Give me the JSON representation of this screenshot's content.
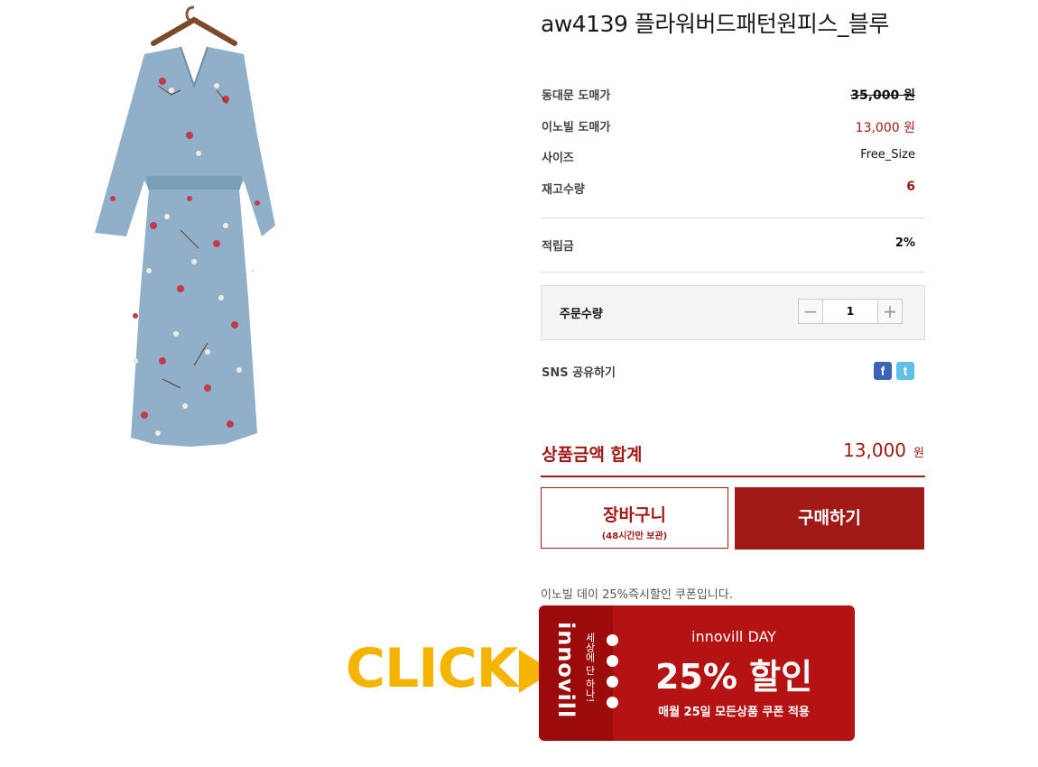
{
  "product": {
    "title": "aw4139 플라워버드패턴원피스_블루",
    "image_icon": "floral-dress-image"
  },
  "info_rows": [
    {
      "label": "동대문 도매가",
      "value": "35,000 원"
    },
    {
      "label": "이노빌 도매가",
      "value": "13,000 원"
    },
    {
      "label": "사이즈",
      "value": "Free_Size"
    },
    {
      "label": "재고수량",
      "value": "6"
    }
  ],
  "points": {
    "label": "적립금",
    "value": "2%"
  },
  "quantity": {
    "label": "주문수량",
    "value": "1",
    "minus": "−",
    "plus": "+"
  },
  "sns": {
    "label": "SNS 공유하기",
    "facebook": "f",
    "twitter": "t"
  },
  "total": {
    "label": "상품금액 합계",
    "value": "13,000",
    "unit": "원"
  },
  "buttons": {
    "cart_label": "장바구니",
    "cart_sub": "(48시간만 보관)",
    "buy_label": "구매하기"
  },
  "coupon": {
    "note": "이노빌  데이 25%즉시할인 쿠폰입니다.",
    "click_text": "CLICK",
    "brand": "innovill",
    "slogan": "세상에 단 하나!",
    "title": "innovill DAY",
    "big": "25% 할인",
    "desc": "매월 25일 모든상품 쿠폰 적용"
  },
  "colors": {
    "accent": "#a01a18",
    "click": "#f5b400",
    "coupon_dark": "#9b0b0b",
    "coupon_main": "#b51214"
  }
}
